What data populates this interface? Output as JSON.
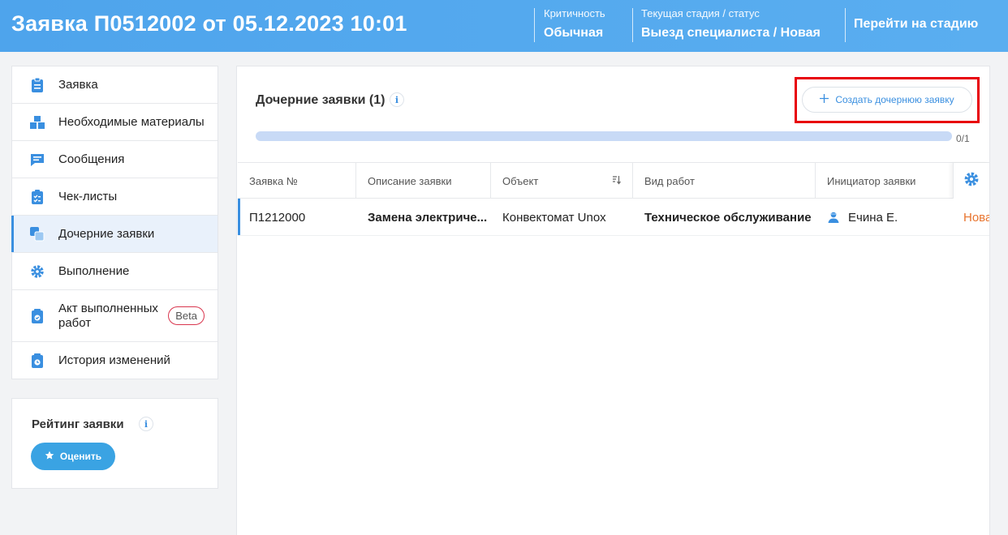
{
  "header": {
    "title": "Заявка П0512002 от 05.12.2023 10:01",
    "criticality_label": "Критичность",
    "criticality_value": "Обычная",
    "stage_label": "Текущая стадия / статус",
    "stage_value": "Выезд специалиста / Новая",
    "goto_stage": "Перейти на стадию"
  },
  "sidebar": {
    "items": [
      {
        "label": "Заявка",
        "icon": "clipboard-icon"
      },
      {
        "label": "Необходимые материалы",
        "icon": "boxes-icon"
      },
      {
        "label": "Сообщения",
        "icon": "chat-icon"
      },
      {
        "label": "Чек-листы",
        "icon": "checklist-icon"
      },
      {
        "label": "Дочерние заявки",
        "icon": "child-requests-icon",
        "active": true
      },
      {
        "label": "Выполнение",
        "icon": "gear-icon"
      },
      {
        "label": "Акт выполненных работ",
        "icon": "act-icon",
        "badge": "Beta"
      },
      {
        "label": "История изменений",
        "icon": "history-icon"
      }
    ]
  },
  "rating": {
    "title": "Рейтинг заявки",
    "button": "Оценить"
  },
  "main": {
    "title": "Дочерние заявки (1)",
    "create_button": "Создать дочернюю заявку",
    "progress_text": "0/1",
    "progress_fraction": 0
  },
  "table": {
    "columns": [
      "Заявка №",
      "Описание заявки",
      "Объект",
      "Вид работ",
      "Инициатор заявки"
    ],
    "rows": [
      {
        "number": "П1212000",
        "description": "Замена электриче...",
        "object": "Конвектомат Unox",
        "work_type": "Техническое обслуживание",
        "initiator": "Ечина Е.",
        "status": "Нова"
      }
    ]
  },
  "colors": {
    "accent": "#3a8fe0",
    "header": "#4ea4ec",
    "highlight": "#e8000a",
    "status_new": "#e8742e",
    "beta_border": "#d9364e"
  }
}
